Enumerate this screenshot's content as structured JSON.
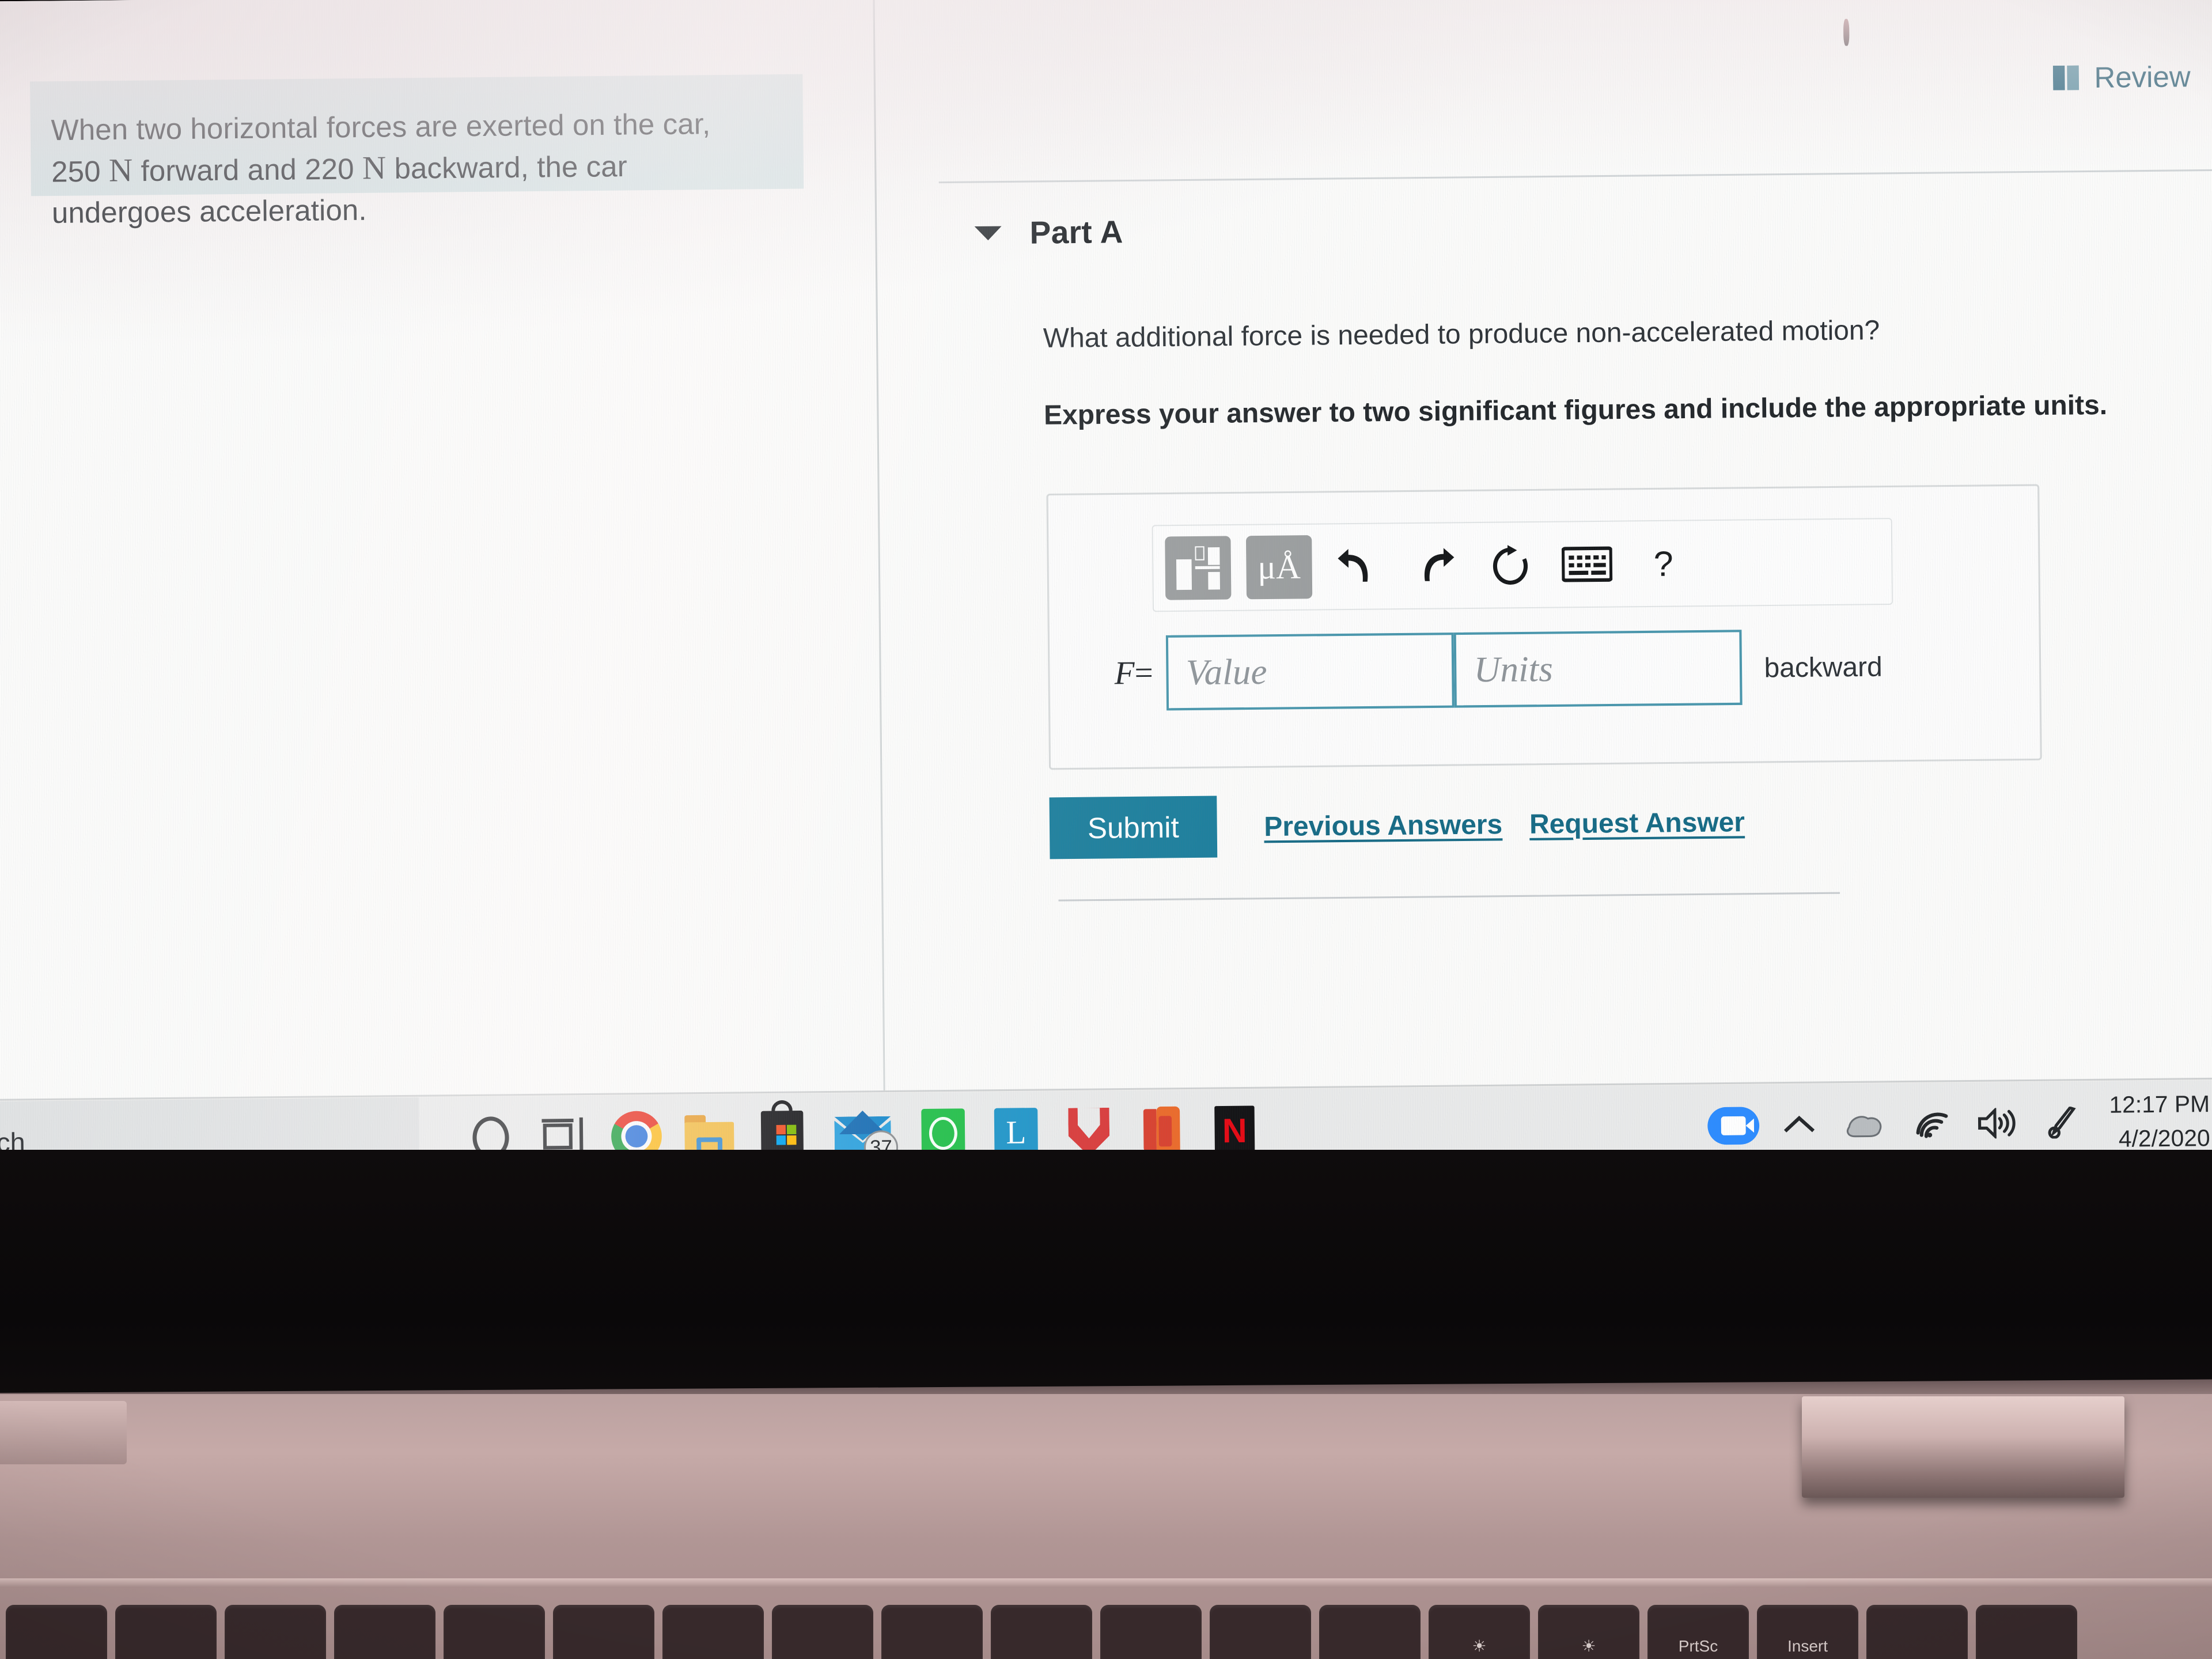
{
  "browser": {
    "problem_statement": "When two horizontal forces are exerted on the car, 250 N forward and 220 N backward, the car undergoes acceleration.",
    "problem_line1_a": "When two horizontal forces are exerted on the car,",
    "problem_line2_a": "250 ",
    "problem_line2_unit1": "N",
    "problem_line2_b": " forward and 220 ",
    "problem_line2_unit2": "N",
    "problem_line2_c": " backward, the car",
    "problem_line3": "undergoes acceleration.",
    "review_label": "Review",
    "review_icon": "book-icon",
    "part_label": "Part A",
    "part_caret_icon": "caret-down-icon",
    "question_prompt": "What additional force is needed to produce non-accelerated motion?",
    "question_instruction": "Express your answer to two significant figures and include the appropriate units.",
    "math_toolbar": [
      {
        "name": "template-icon",
        "label": "",
        "boxed": true
      },
      {
        "name": "units-micro-angstrom-icon",
        "label": "μÅ",
        "boxed": true
      },
      {
        "name": "undo-icon",
        "label": "↶",
        "boxed": false
      },
      {
        "name": "redo-icon",
        "label": "↷",
        "boxed": false
      },
      {
        "name": "reset-icon",
        "label": "↺",
        "boxed": false
      },
      {
        "name": "keyboard-icon",
        "label": "⌨",
        "boxed": false
      },
      {
        "name": "help-icon",
        "label": "?",
        "boxed": false
      }
    ],
    "answer": {
      "variable_label": "F",
      "equals": "=",
      "value_placeholder": "Value",
      "value_text": "",
      "units_placeholder": "Units",
      "units_text": "",
      "direction_suffix": "backward"
    },
    "submit_label": "Submit",
    "previous_answers_label": "Previous Answers",
    "request_answer_label": "Request Answer",
    "accent_teal": "#1b7e9c",
    "link_teal": "#176b86",
    "field_border": "#4a97ad",
    "problem_box_bg": "#d9e8e9"
  },
  "taskbar": {
    "search_text": "arch",
    "search_full_hint": "Type here to search",
    "items": [
      {
        "name": "cortana-icon",
        "label": "Cortana",
        "active": false
      },
      {
        "name": "task-view-icon",
        "label": "Task View",
        "active": false
      },
      {
        "name": "chrome-icon",
        "label": "Google Chrome",
        "active": true
      },
      {
        "name": "file-explorer-icon",
        "label": "File Explorer",
        "active": false
      },
      {
        "name": "microsoft-store-icon",
        "label": "Microsoft Store",
        "active": false
      },
      {
        "name": "mail-icon",
        "label": "Mail",
        "active": false,
        "badge": "37"
      },
      {
        "name": "spotify-icon",
        "label": "Spotify",
        "active": false
      },
      {
        "name": "lenovo-vantage-icon",
        "label": "L",
        "active": false
      },
      {
        "name": "mcafee-icon",
        "label": "McAfee",
        "active": false
      },
      {
        "name": "office-icon",
        "label": "Office",
        "active": false
      },
      {
        "name": "netflix-icon",
        "label": "N",
        "active": false
      }
    ],
    "tray": [
      {
        "name": "zoom-icon",
        "label": "Zoom"
      },
      {
        "name": "show-hidden-icons-chevron-icon",
        "label": "∧"
      },
      {
        "name": "onedrive-cloud-icon",
        "label": "OneDrive"
      },
      {
        "name": "wifi-icon",
        "label": "Wi-Fi"
      },
      {
        "name": "volume-icon",
        "label": "Volume"
      },
      {
        "name": "pen-menu-icon",
        "label": "Windows Ink"
      }
    ],
    "clock_time": "12:17 PM",
    "clock_date": "4/2/2020"
  },
  "laptop": {
    "keys": [
      "",
      "",
      "",
      "",
      "",
      "",
      "",
      "",
      "",
      "",
      "",
      "",
      "",
      "☀",
      "☀",
      "PrtSc",
      "Insert",
      "",
      ""
    ]
  }
}
